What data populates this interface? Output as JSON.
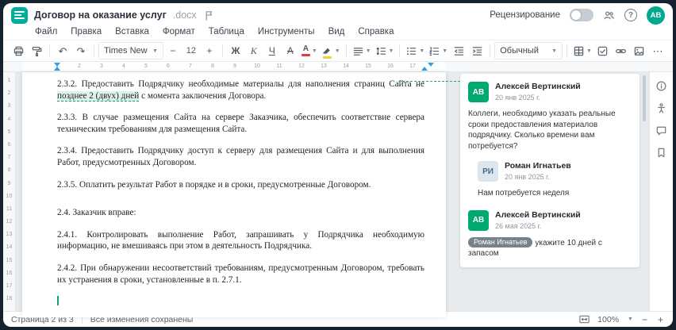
{
  "titlebar": {
    "title": "Договор на оказание услуг",
    "extension": ".docx",
    "review_label": "Рецензирование",
    "avatar_initials": "АВ"
  },
  "menu": [
    "Файл",
    "Правка",
    "Вставка",
    "Формат",
    "Таблица",
    "Инструменты",
    "Вид",
    "Справка"
  ],
  "toolbar": {
    "font_family": "Times New",
    "font_size": "12",
    "size_minus": "−",
    "size_plus": "+",
    "bold": "Ж",
    "italic": "К",
    "underline": "Ч",
    "strikethrough": "А",
    "font_color": "А",
    "style_name": "Обычный",
    "more": "⋯",
    "undo": "↶",
    "redo": "↷"
  },
  "ruler": {
    "h": [
      "1",
      "2",
      "3",
      "4",
      "5",
      "6",
      "7",
      "8",
      "9",
      "10",
      "11",
      "12",
      "13",
      "14",
      "15",
      "16",
      "17"
    ],
    "v": [
      "1",
      "2",
      "3",
      "4",
      "5",
      "6",
      "7",
      "8",
      "9",
      "10",
      "11",
      "12",
      "13",
      "14",
      "15",
      "16",
      "17",
      "18"
    ]
  },
  "document": {
    "p1_pre": "2.3.2. Предоставить Подрядчику необходимые материалы для наполнения страниц Сайта не ",
    "p1_anchor": "позднее 2 (двух) дней",
    "p1_post": " с момента заключения Договора.",
    "p2": "2.3.3. В случае размещения Сайта на сервере Заказчика, обеспечить соответствие сервера техническим требованиям для размещения Сайта.",
    "p3": "2.3.4. Предоставить Подрядчику доступ к серверу для размещения Сайта и для выполнения Работ, предусмотренных Договором.",
    "p4": "2.3.5. Оплатить результат Работ в порядке и в сроки, предусмотренные Договором.",
    "p5": "2.4. Заказчик вправе:",
    "p6": "2.4.1. Контролировать выполнение Работ, запрашивать у Подрядчика необходимую информацию, не вмешиваясь при этом в деятельность Подрядчика.",
    "p7": "2.4.2. При обнаружении несоответствий требованиям, предусмотренным Договором, требовать их устранения в сроки, установленные в п. 2.7.1."
  },
  "comments": {
    "thread": [
      {
        "initials": "АВ",
        "name": "Алексей Вертинский",
        "date": "20 янв 2025 г.",
        "text": "Коллеги, необходимо указать реальные сроки предоставления материалов подрядчику. Сколько времени вам потребуется?"
      },
      {
        "initials": "РИ",
        "name": "Роман Игнатьев",
        "date": "20 янв 2025 г.",
        "text": "Нам потребуется неделя"
      },
      {
        "initials": "АВ",
        "name": "Алексей Вертинский",
        "date": "26 мая 2025 г.",
        "mention": "Роман Игнатьев",
        "text": "укажите 10 дней с запасом"
      }
    ]
  },
  "statusbar": {
    "page_info": "Страница 2 из 3",
    "save_status": "Все изменения сохранены",
    "zoom": "100%",
    "zoom_out": "−",
    "zoom_in": "+"
  },
  "colors": {
    "accent": "#00A88E",
    "logo": "#00AE9B",
    "comment_avatar_green": "#00A872",
    "reply_avatar_bg": "#DDE6EF",
    "reply_avatar_text": "#49688F",
    "anchor_highlight": "#DCF2EA",
    "anchor_underline": "#12A385",
    "font_color_bar": "#E23D3D",
    "highlight_bar": "#F2CF3A",
    "ruler_marker_blue": "#2F9FE3"
  }
}
